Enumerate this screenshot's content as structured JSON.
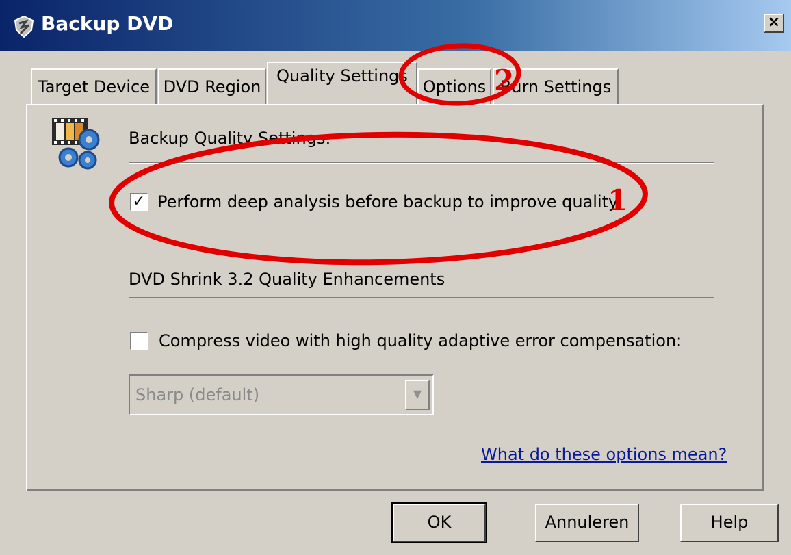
{
  "window": {
    "title": "Backup DVD",
    "close_label": "×"
  },
  "tabs": [
    {
      "label": "Target Device"
    },
    {
      "label": "DVD Region"
    },
    {
      "label": "Quality Settings"
    },
    {
      "label": "Options"
    },
    {
      "label": "Burn Settings"
    }
  ],
  "sections": {
    "backup_quality": {
      "heading": "Backup Quality Settings:",
      "checkbox_label": "Perform deep analysis before backup to improve quality.",
      "checkbox_checked": true
    },
    "enhancements": {
      "heading": "DVD Shrink 3.2 Quality Enhancements",
      "checkbox_label": "Compress video with high quality adaptive error compensation:",
      "checkbox_checked": false,
      "select_value": "Sharp (default)"
    }
  },
  "help_link": "What do these options mean?",
  "buttons": {
    "ok": "OK",
    "cancel": "Annuleren",
    "help": "Help"
  },
  "annotations": {
    "marker1": "1",
    "marker2": "2",
    "color": "#e00000"
  },
  "icons": {
    "app": "shield-icon",
    "settings": "film-gears-icon"
  },
  "colors": {
    "titlebar_start": "#0a246a",
    "titlebar_end": "#a6caf0",
    "dialog": "#d4d0c8",
    "link": "#0a1a9a"
  }
}
